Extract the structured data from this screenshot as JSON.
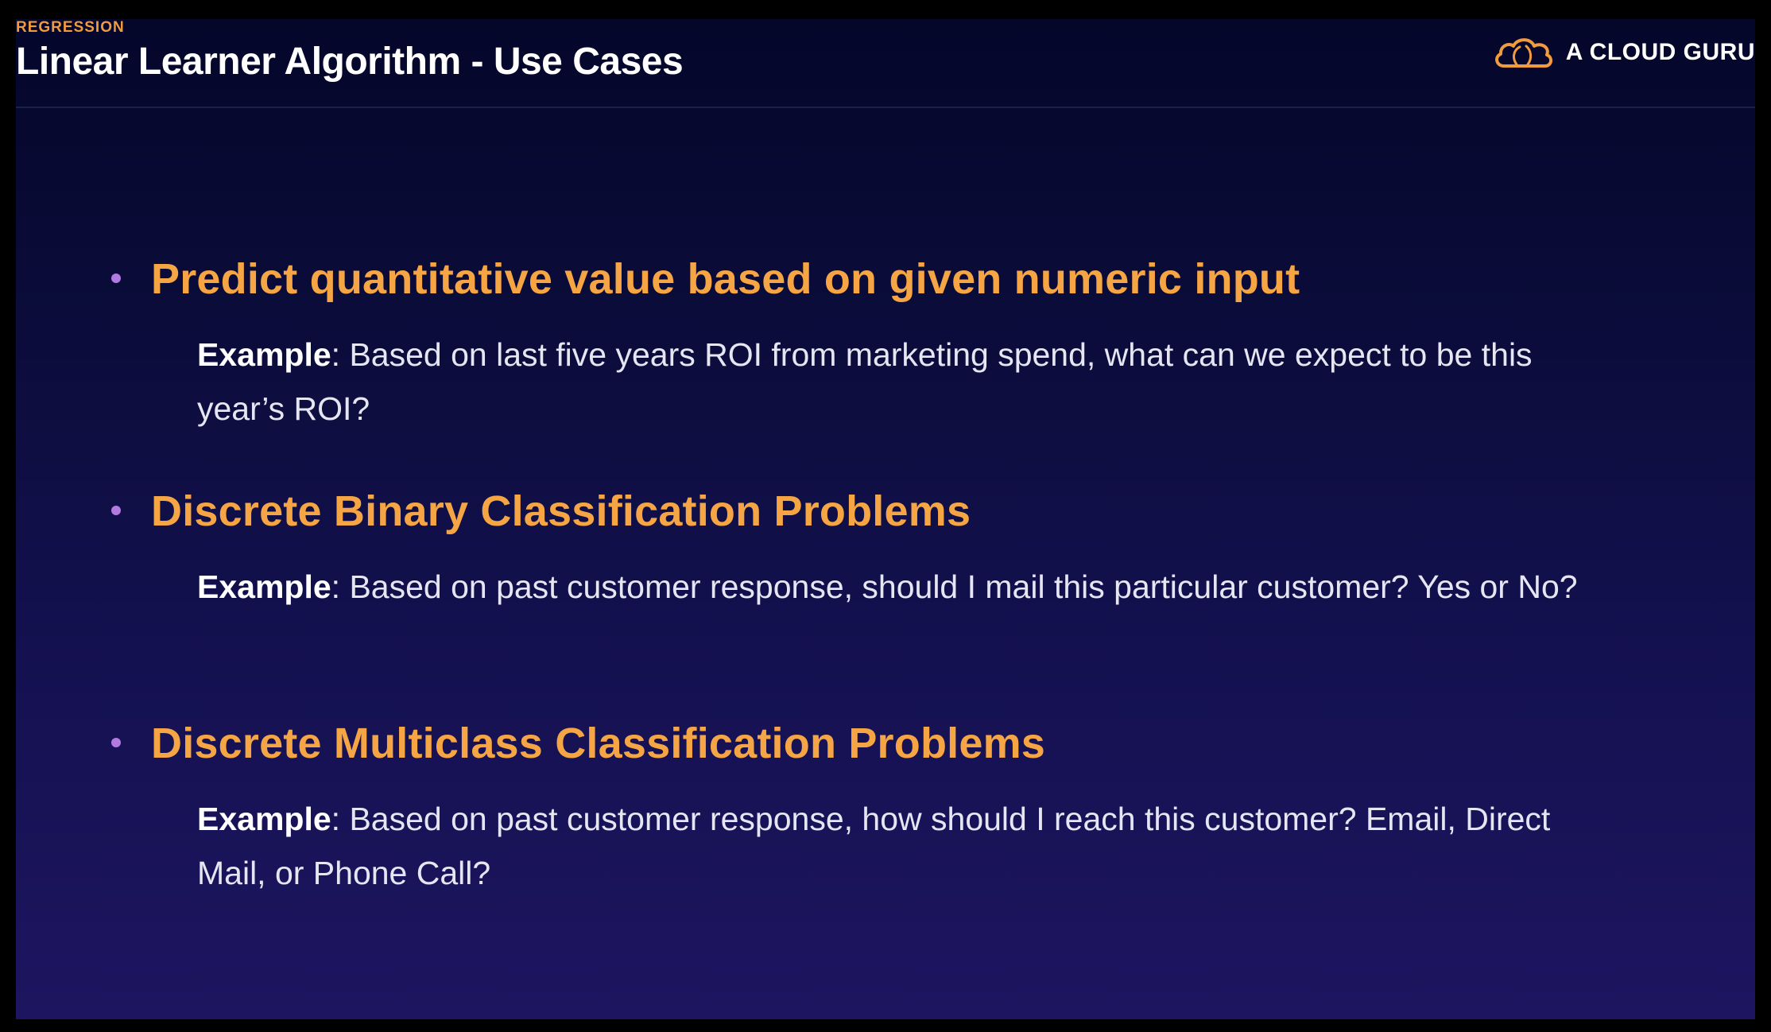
{
  "header": {
    "eyebrow": "REGRESSION",
    "title": "Linear Learner Algorithm - Use Cases"
  },
  "brand": {
    "name": "A CLOUD GURU",
    "logo_icon": "cloud-icon",
    "logo_color": "#f19a3e"
  },
  "use_cases": [
    {
      "heading": "Predict quantitative value based on given numeric input",
      "example_label": "Example",
      "example_text": ": Based on last five years ROI from marketing spend, what can we expect to be this year’s ROI?"
    },
    {
      "heading": "Discrete Binary Classification Problems",
      "example_label": "Example",
      "example_text": ": Based on past customer response, should I mail this particular customer? Yes or No?"
    },
    {
      "heading": "Discrete Multiclass Classification Problems",
      "example_label": "Example",
      "example_text": ": Based on past customer response, how should I reach this customer? Email, Direct Mail, or Phone Call?"
    }
  ],
  "colors": {
    "heading": "#f6a544",
    "eyebrow": "#f19a3e",
    "bullet": "#b07ae0",
    "body_text": "#e6e6f2",
    "background_top": "#04062a",
    "background_bottom": "#1e1560"
  }
}
